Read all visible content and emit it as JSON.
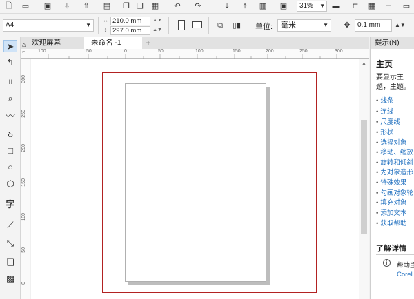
{
  "toolbar": {
    "zoom_value": "31%",
    "icons": [
      "new-document-icon",
      "open-icon",
      "save-icon",
      "undo-icon",
      "redo-icon",
      "import-icon",
      "export-icon",
      "zoom-fit-icon"
    ]
  },
  "property_bar": {
    "page_size": "A4",
    "width": "210.0 mm",
    "height": "297.0 mm",
    "unit_label": "单位:",
    "unit_value": "毫米",
    "nudge": "0.1 mm"
  },
  "tabs": [
    {
      "label": "欢迎屏幕"
    },
    {
      "label": "未命名 -1"
    }
  ],
  "ruler": {
    "unit": "毫米",
    "h_labels": [
      "100",
      "50",
      "0",
      "50",
      "100",
      "150",
      "200",
      "250",
      "300"
    ],
    "v_labels": [
      "300",
      "250",
      "200",
      "150",
      "100",
      "50",
      "0"
    ]
  },
  "hints_panel": {
    "title": "提示(N)",
    "heading": "主页",
    "intro": "要显示主题，主题。",
    "links": [
      "线条",
      "连线",
      "尺度线",
      "形状",
      "选择对象",
      "移动、缩放",
      "旋转和倾斜",
      "为对象造形",
      "特殊效果",
      "勾画对象轮",
      "填充对象",
      "添加文本",
      "获取帮助"
    ],
    "learn_more": "了解详情",
    "help_label": "帮助主",
    "corel_label": "Corel"
  },
  "colors": {
    "highlight": "#b22222",
    "link": "#1f6fbf"
  }
}
